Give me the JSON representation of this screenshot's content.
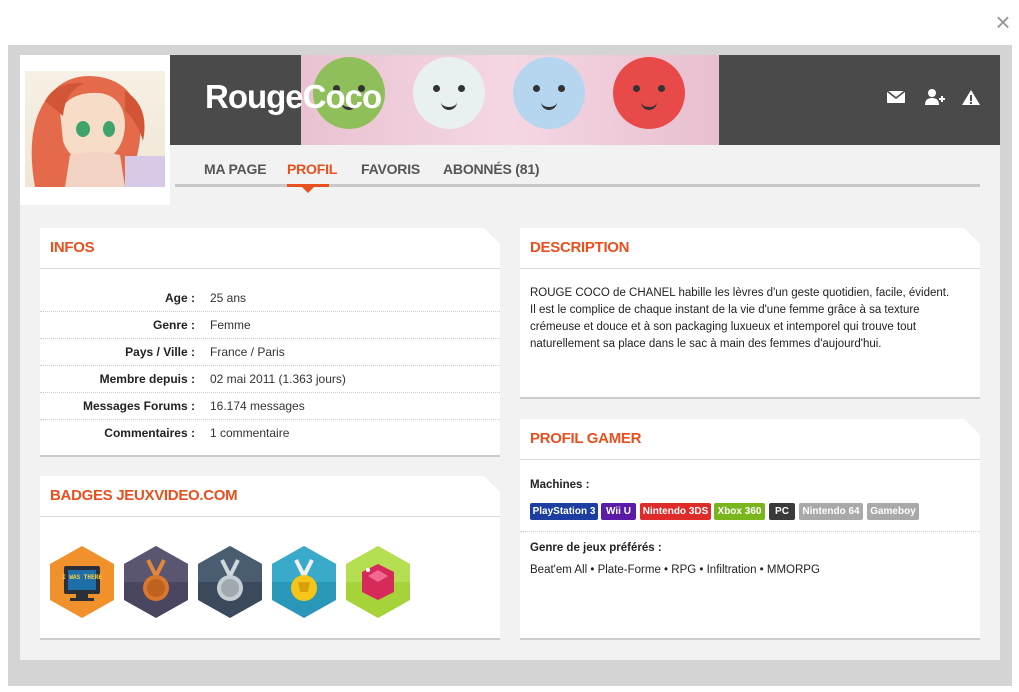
{
  "profile": {
    "username": "RougeCoco"
  },
  "tabs": [
    {
      "label": "MA PAGE"
    },
    {
      "label": "PROFIL"
    },
    {
      "label": "FAVORIS"
    },
    {
      "label": "ABONNÉS (81)"
    }
  ],
  "infos": {
    "title": "INFOS",
    "rows": [
      {
        "label": "Age :",
        "value": "25 ans"
      },
      {
        "label": "Genre :",
        "value": "Femme"
      },
      {
        "label": "Pays / Ville :",
        "value": "France / Paris"
      },
      {
        "label": "Membre depuis :",
        "value": "02 mai 2011 (1.363 jours)"
      },
      {
        "label": "Messages Forums :",
        "value": "16.174 messages"
      },
      {
        "label": "Commentaires :",
        "value": "1 commentaire"
      }
    ]
  },
  "badges": {
    "title": "BADGES JEUXVIDEO.COM",
    "items": [
      {
        "icon": "i-was-there-badge-icon",
        "text": "I WAS THERE",
        "color": "#f0912c"
      },
      {
        "icon": "bronze-medal-badge-icon",
        "color": "#4a4660"
      },
      {
        "icon": "silver-medal-badge-icon",
        "color": "#3a4a5c"
      },
      {
        "icon": "gold-trophy-badge-icon",
        "color": "#2a97b8"
      },
      {
        "icon": "ruby-gem-badge-icon",
        "color": "#a6d23a"
      }
    ]
  },
  "description": {
    "title": "DESCRIPTION",
    "line1": "ROUGE COCO de CHANEL habille les lèvres d'un geste quotidien, facile, évident.",
    "line2": "Il est le complice de chaque instant de la vie d'une femme grâce à sa texture crémeuse et douce et à son packaging luxueux et intemporel qui trouve tout naturellement sa place dans le sac à main des femmes d'aujourd'hui."
  },
  "gamer": {
    "title": "PROFIL GAMER",
    "machines_label": "Machines :",
    "machines": [
      {
        "label": "PlayStation 3",
        "color": "#1b3ea0"
      },
      {
        "label": "Wii U",
        "color": "#5b1aa8"
      },
      {
        "label": "Nintendo 3DS",
        "color": "#e02b2b"
      },
      {
        "label": "Xbox 360",
        "color": "#7ab51d"
      },
      {
        "label": "PC",
        "color": "#3a3a3a"
      },
      {
        "label": "Nintendo 64",
        "color": "#a9a9a9"
      },
      {
        "label": "Gameboy",
        "color": "#a9a9a9"
      }
    ],
    "genres_label": "Genre de jeux préférés :",
    "genres": "Beat'em All • Plate-Forme • RPG • Infiltration • MMORPG"
  },
  "header_icons": [
    "mail-icon",
    "add-friend-icon",
    "report-warning-icon"
  ],
  "colors": {
    "accent": "#e8501e",
    "header_bg": "#4a4a4a"
  }
}
